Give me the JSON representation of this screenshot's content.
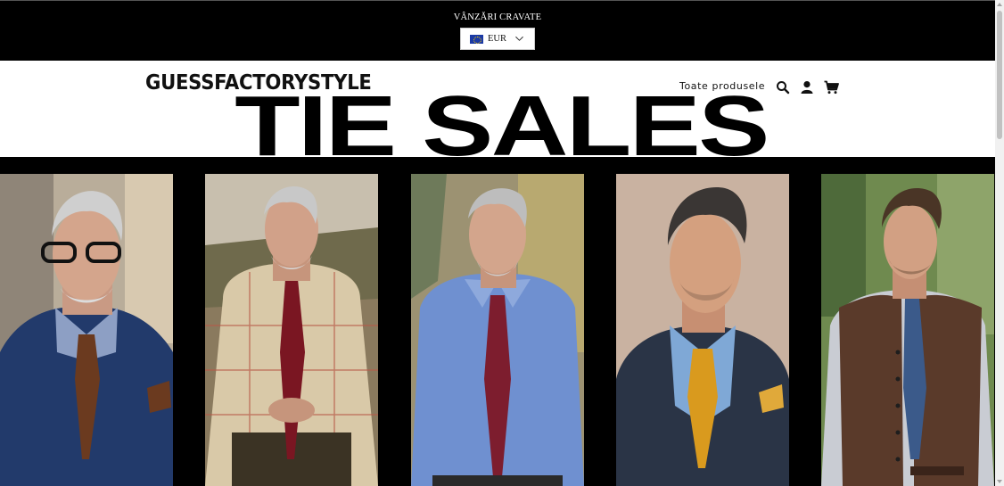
{
  "announcement": {
    "text": "VÂNZĂRI CRAVATE"
  },
  "currency": {
    "code": "EUR",
    "flag_icon": "eu-flag-icon"
  },
  "header": {
    "logo": "GUESSFACTORYSTYLE",
    "nav_link": "Toate produsele",
    "icons": [
      "search-icon",
      "account-icon",
      "cart-icon"
    ]
  },
  "hero": {
    "title": "TIE SALES"
  },
  "gallery": {
    "items": [
      {
        "name": "product-photo-1",
        "tie_color": "#6b3a1f",
        "shirt_color": "#8d9fc4",
        "jacket_color": "#223a6b"
      },
      {
        "name": "product-photo-2",
        "tie_color": "#7a1622",
        "shirt_color": "#d9c9a8",
        "jacket_color": ""
      },
      {
        "name": "product-photo-3",
        "tie_color": "#7d1d2e",
        "shirt_color": "#6f90d0",
        "jacket_color": ""
      },
      {
        "name": "product-photo-4",
        "tie_color": "#d99a1e",
        "shirt_color": "#7fa8d6",
        "jacket_color": "#2a3446"
      },
      {
        "name": "product-photo-5",
        "tie_color": "#3b5a8a",
        "shirt_color": "#c9ccd3",
        "jacket_color": "#5a3a2a"
      }
    ]
  }
}
